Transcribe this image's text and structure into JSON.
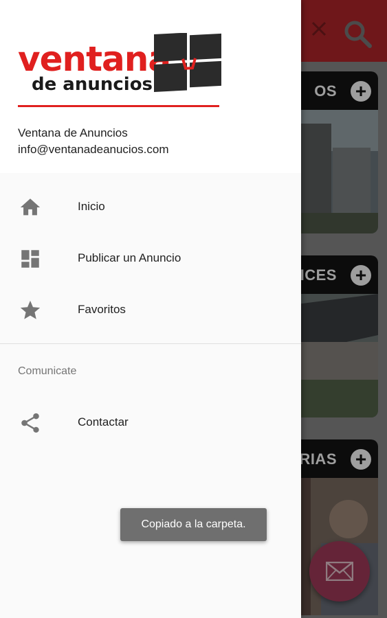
{
  "drawer": {
    "logo": {
      "word1": "ventana",
      "word2": "de anuncios"
    },
    "header": {
      "name": "Ventana de Anuncios",
      "email": "info@ventanadeanucios.com"
    },
    "items": [
      {
        "label": "Inicio",
        "icon": "home-icon"
      },
      {
        "label": "Publicar un Anuncio",
        "icon": "dashboard-icon"
      },
      {
        "label": "Favoritos",
        "icon": "star-icon"
      }
    ],
    "section_title": "Comunicate",
    "section_items": [
      {
        "label": "Contactar",
        "icon": "share-icon"
      }
    ]
  },
  "toast": {
    "text": "Copiado a la carpeta."
  },
  "background": {
    "cards": [
      {
        "title_fragment": "OS"
      },
      {
        "title_fragment": "AICES"
      },
      {
        "title_fragment": "ARIAS"
      }
    ],
    "fab_icon": "mail-icon"
  },
  "colors": {
    "brand_red": "#e0201f",
    "appbar_red": "#b3262a",
    "fab": "#a33a5b"
  }
}
